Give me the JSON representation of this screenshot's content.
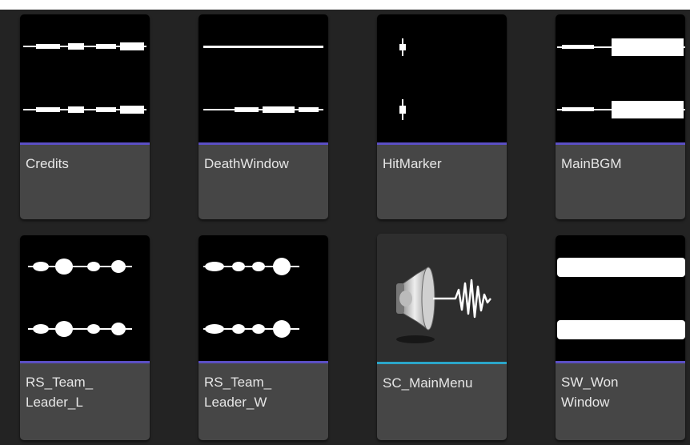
{
  "colors": {
    "accent_bar": "#5b4fc4",
    "selected_bar": "#2ba6c9",
    "label_bg": "#464646",
    "label_text": "#e6e6e6",
    "background": "#232323"
  },
  "assets": [
    {
      "label": "Credits",
      "icon": "waveform-icon",
      "selected": false
    },
    {
      "label": "DeathWindow",
      "icon": "waveform-icon",
      "selected": false
    },
    {
      "label": "HitMarker",
      "icon": "waveform-icon",
      "selected": false
    },
    {
      "label": "MainBGM",
      "icon": "waveform-icon",
      "selected": false
    },
    {
      "label": "RS_Team_\nLeader_L",
      "icon": "waveform-icon",
      "selected": false
    },
    {
      "label": "RS_Team_\nLeader_W",
      "icon": "waveform-icon",
      "selected": false
    },
    {
      "label": "SC_MainMenu",
      "icon": "speaker-icon",
      "selected": true
    },
    {
      "label": "SW_Won\nWindow",
      "icon": "waveform-icon",
      "selected": false
    }
  ]
}
